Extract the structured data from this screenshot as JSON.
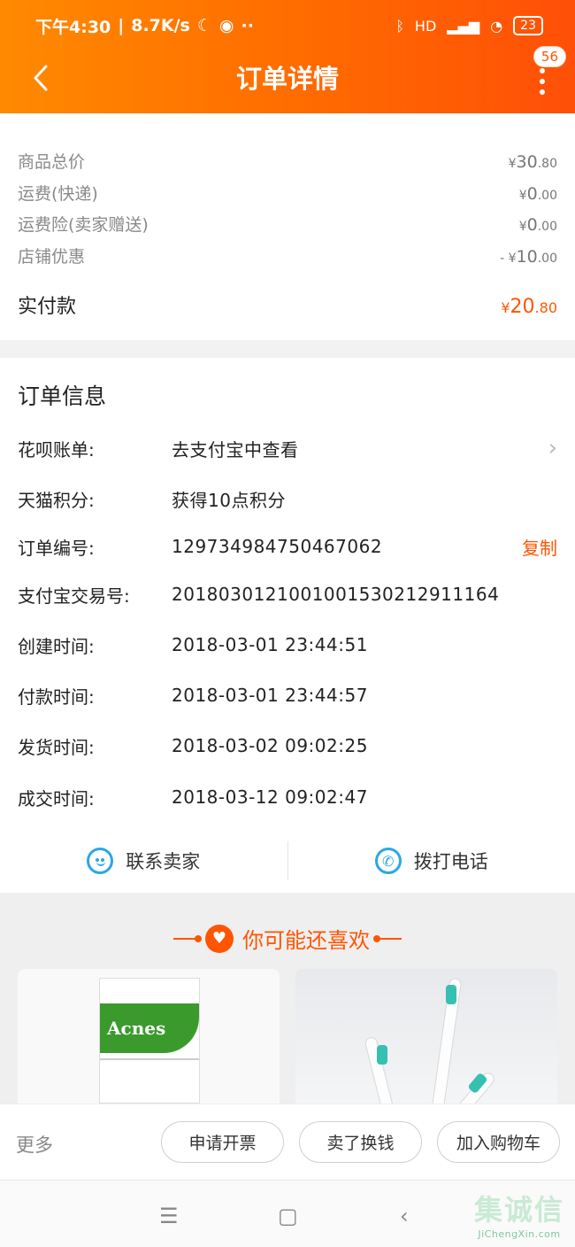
{
  "status_bar": {
    "time": "下午4:30",
    "speed": "8.7K/s",
    "signal": "HD",
    "battery": "23"
  },
  "header": {
    "title": "订单详情",
    "badge": "56"
  },
  "price": {
    "rows": [
      {
        "label": "商品总价",
        "currency": "¥",
        "int": "30",
        "dec": ".80"
      },
      {
        "label": "运费(快递)",
        "currency": "¥",
        "int": "0",
        "dec": ".00"
      },
      {
        "label": "运费险(卖家赠送)",
        "currency": "¥",
        "int": "0",
        "dec": ".00"
      },
      {
        "label": "店铺优惠",
        "currency": "- ¥",
        "int": "10",
        "dec": ".00"
      }
    ],
    "total": {
      "label": "实付款",
      "currency": "¥",
      "int": "20",
      "dec": ".80"
    }
  },
  "order_info": {
    "title": "订单信息",
    "rows": [
      {
        "key": "花呗账单:",
        "value": "去支付宝中查看"
      },
      {
        "key": "天猫积分:",
        "value": "获得10点积分"
      },
      {
        "key": "订单编号:",
        "value": "129734984750467062",
        "action": "复制"
      },
      {
        "key": "支付宝交易号:",
        "value": "2018030121001001530212911164"
      },
      {
        "key": "创建时间:",
        "value": "2018-03-01 23:44:51"
      },
      {
        "key": "付款时间:",
        "value": "2018-03-01 23:44:57"
      },
      {
        "key": "发货时间:",
        "value": "2018-03-02 09:02:25"
      },
      {
        "key": "成交时间:",
        "value": "2018-03-12 09:02:47"
      }
    ],
    "contact_seller": "联系卖家",
    "call_phone": "拨打电话"
  },
  "recommend": {
    "title": "你可能还喜欢",
    "product_left_brand": "Acnes"
  },
  "bottom_bar": {
    "more": "更多",
    "invoice": "申请开票",
    "resell": "卖了换钱",
    "add_cart": "加入购物车"
  },
  "watermark": {
    "cn": "集诚信",
    "en": "JiChengXin.com"
  },
  "colors": {
    "accent": "#ff5500",
    "header_start": "#ff8a00",
    "header_end": "#ff4f08",
    "icon_blue": "#2aa7e6"
  }
}
